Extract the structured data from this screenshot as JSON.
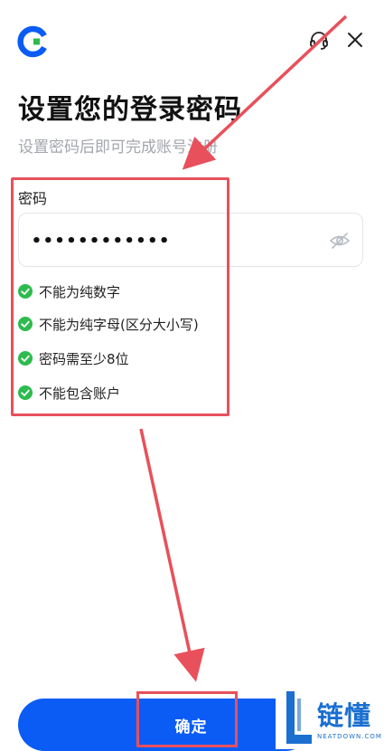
{
  "header": {
    "logo_icon": "brand-logo-icon",
    "support_icon": "headset-icon",
    "close_icon": "close-icon"
  },
  "title": "设置您的登录密码",
  "subtitle": "设置密码后即可完成账号注册",
  "password": {
    "label": "密码",
    "value": "••••••••••••",
    "visibility_icon": "eye-off-icon"
  },
  "rules": [
    {
      "text": "不能为纯数字",
      "status": "passed"
    },
    {
      "text": "不能为纯字母(区分大小写)",
      "status": "passed"
    },
    {
      "text": "密码需至少8位",
      "status": "passed"
    },
    {
      "text": "不能包含账户",
      "status": "passed"
    }
  ],
  "confirm_label": "确定",
  "watermark": {
    "title": "链懂",
    "subtitle": "NEATDOWN.COM"
  },
  "colors": {
    "primary": "#0a5cf5",
    "check": "#2dbb4e",
    "annotation": "#e8505b",
    "subtitle": "#a3a6ad"
  }
}
